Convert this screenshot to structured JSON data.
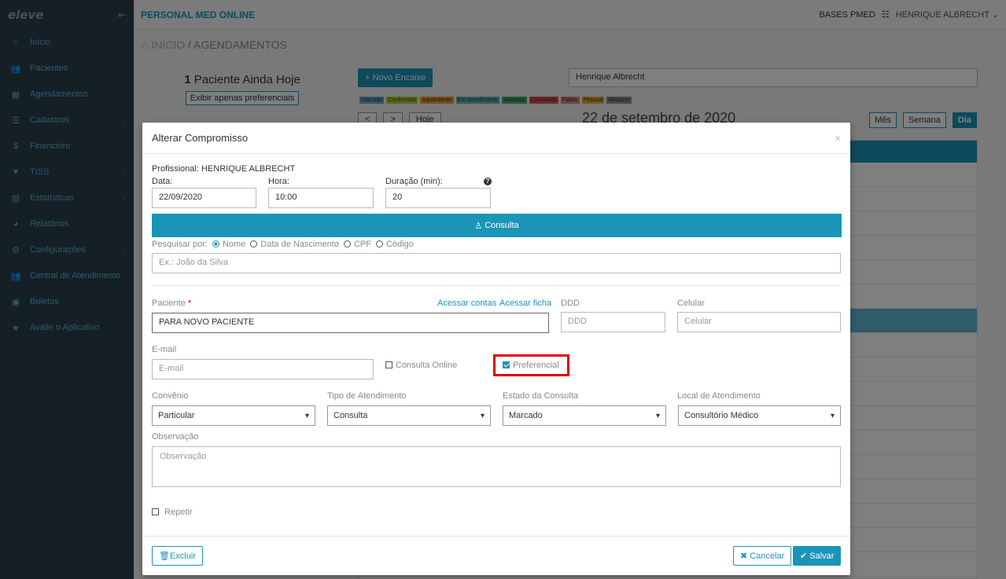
{
  "sidebar": {
    "logo": "eleve",
    "items": [
      {
        "label": "Início",
        "icon": "home-icon",
        "glyph": "⌂",
        "chev": ""
      },
      {
        "label": "Pacientes",
        "icon": "users-icon",
        "glyph": "👥",
        "chev": ""
      },
      {
        "label": "Agendamentos",
        "icon": "calendar-icon",
        "glyph": "▦",
        "chev": ""
      },
      {
        "label": "Cadastros",
        "icon": "list-icon",
        "glyph": "☰",
        "chev": "‹"
      },
      {
        "label": "Financeiro",
        "icon": "dollar-icon",
        "glyph": "$",
        "chev": ""
      },
      {
        "label": "TISS",
        "icon": "heartbeat-icon",
        "glyph": "♥",
        "chev": "‹"
      },
      {
        "label": "Estatísticas",
        "icon": "bar-chart-icon",
        "glyph": "▥",
        "chev": "‹"
      },
      {
        "label": "Relatórios",
        "icon": "pie-chart-icon",
        "glyph": "◕",
        "chev": "‹"
      },
      {
        "label": "Configurações",
        "icon": "gear-icon",
        "glyph": "⚙",
        "chev": "‹"
      },
      {
        "label": "Central de Atendimento",
        "icon": "users-icon",
        "glyph": "👥",
        "chev": ""
      },
      {
        "label": "Boletos",
        "icon": "money-icon",
        "glyph": "▣",
        "chev": ""
      },
      {
        "label": "Avalie o Aplicativo",
        "icon": "star-icon",
        "glyph": "★",
        "chev": ""
      }
    ]
  },
  "topbar": {
    "app_title": "PERSONAL MED ONLINE",
    "bases": "BASES PMED",
    "user": "HENRIQUE ALBRECHT"
  },
  "breadcrumb": {
    "home": "INÍCIO",
    "sep": "/",
    "current": "AGENDAMENTOS"
  },
  "background": {
    "patient_count": "1",
    "patient_text": "Paciente Ainda Hoje",
    "pref_button": "Exibir apenas preferenciais",
    "new_button": "Novo Encaixe",
    "professional_select": "Henrique Albrecht",
    "legend": [
      {
        "label": "Marcado",
        "color": "#6aa9c9"
      },
      {
        "label": "Confirmado",
        "color": "#b5d334"
      },
      {
        "label": "Aguardando",
        "color": "#f0a030"
      },
      {
        "label": "Em Atendimento",
        "color": "#5fb8b0"
      },
      {
        "label": "Atendido",
        "color": "#3cb371"
      },
      {
        "label": "Cancelado",
        "color": "#e05050"
      },
      {
        "label": "Faltou",
        "color": "#e08080"
      },
      {
        "label": "Pessoal",
        "color": "#e0b030"
      },
      {
        "label": "Bloqueio",
        "color": "#909090"
      }
    ],
    "nav_prev": "<",
    "nav_next": ">",
    "nav_today": "Hoje",
    "date": "22 de setembro de 2020",
    "views": [
      "Mês",
      "Semana",
      "Dia"
    ]
  },
  "modal": {
    "title": "Alterar Compromisso",
    "close": "×",
    "professional": "Profissional: HENRIQUE ALBRECHT",
    "data_label": "Data:",
    "data_value": "22/09/2020",
    "hora_label": "Hora:",
    "hora_value": "10:00",
    "duracao_label": "Duração (min):",
    "duracao_value": "20",
    "consulta_bar": "Consulta",
    "search_by": "Pesquisar por:",
    "search_options": [
      "Nome",
      "Data de Nascimento",
      "CPF",
      "Código"
    ],
    "search_placeholder": "Ex.: João da Silva",
    "paciente_label": "Paciente",
    "req": "*",
    "acessar_contas": "Acessar contas",
    "acessar_ficha": "Acessar ficha",
    "paciente_value": "PARA NOVO PACIENTE",
    "ddd_label": "DDD",
    "ddd_placeholder": "DDD",
    "celular_label": "Celular",
    "celular_placeholder": "Celular",
    "email_label": "E-mail",
    "email_placeholder": "E-mail",
    "consulta_online": "Consulta Online",
    "preferencial": "Preferencial",
    "preferencial_checked": true,
    "convenio_label": "Convênio",
    "convenio_value": "Particular",
    "tipo_label": "Tipo de Atendimento",
    "tipo_value": "Consulta",
    "estado_label": "Estado da Consulta",
    "estado_value": "Marcado",
    "local_label": "Local de Atendimento",
    "local_value": "Consultório Médico",
    "observacao_label": "Observação",
    "observacao_placeholder": "Observação",
    "repetir": "Repetir",
    "excluir": "Excluir",
    "cancelar": "Cancelar",
    "salvar": "Salvar"
  }
}
